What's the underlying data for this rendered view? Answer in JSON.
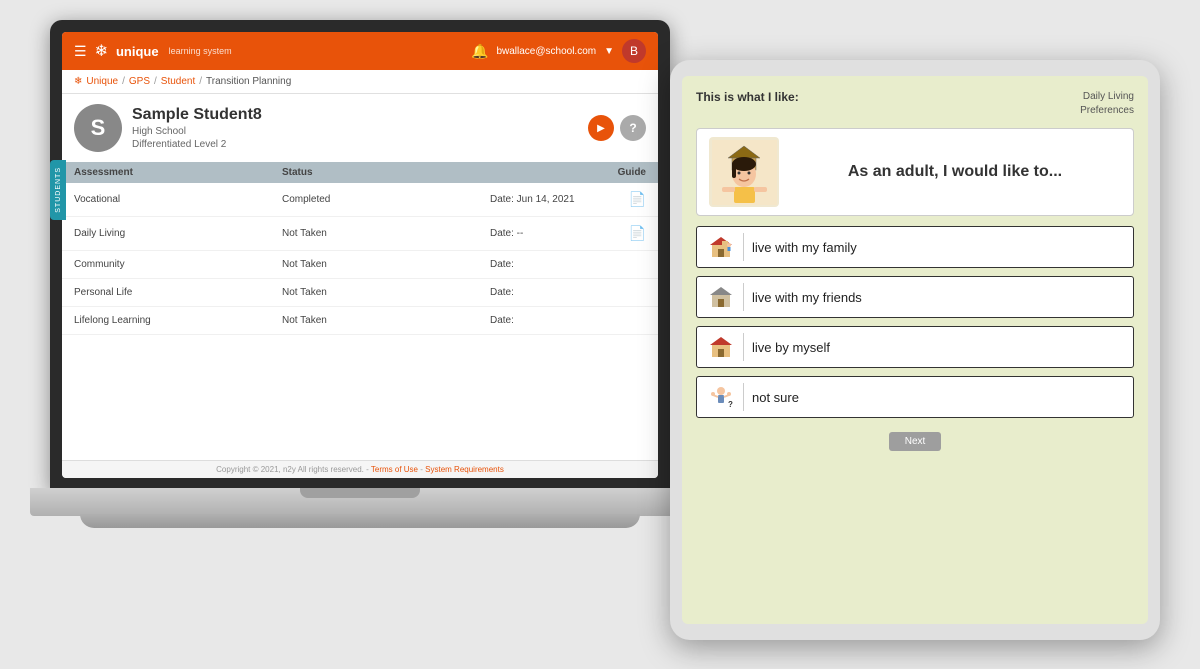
{
  "app": {
    "header": {
      "menu_icon": "☰",
      "logo_snowflake": "❄",
      "logo_text": "unique",
      "logo_sub": "learning system",
      "bell_icon": "🔔",
      "user_email": "bwallace@school.com",
      "chevron": "▼",
      "avatar_letter": "B"
    },
    "breadcrumb": {
      "unique": "Unique",
      "sep1": "/",
      "gps": "GPS",
      "sep2": "/",
      "student": "Student",
      "sep3": "/",
      "current": "Transition Planning"
    },
    "student": {
      "avatar_letter": "S",
      "name": "Sample Student8",
      "school_level": "High School",
      "diff_level": "Differentiated Level 2",
      "play_icon": "▶",
      "help_icon": "?"
    },
    "students_tab": "STUDENTS",
    "table": {
      "headers": [
        "Assessment",
        "Status",
        "Guide"
      ],
      "rows": [
        {
          "assessment": "Vocational",
          "status": "Completed",
          "date": "Date: Jun 14, 2021",
          "has_pdf": true
        },
        {
          "assessment": "Daily Living",
          "status": "Not Taken",
          "date": "Date: --",
          "has_pdf": true
        },
        {
          "assessment": "Community",
          "status": "Not Taken",
          "date": "Date:",
          "has_pdf": false
        },
        {
          "assessment": "Personal Life",
          "status": "Not Taken",
          "date": "Date:",
          "has_pdf": false
        },
        {
          "assessment": "Lifelong Learning",
          "status": "Not Taken",
          "date": "Date:",
          "has_pdf": false
        }
      ]
    },
    "footer": {
      "copyright": "Copyright © 2021, n2y All rights reserved. -",
      "terms_link": "Terms of Use",
      "separator": "-",
      "system_link": "System Requirements"
    }
  },
  "tablet": {
    "title": "This is what I like:",
    "section_line1": "Daily Living",
    "section_line2": "Preferences",
    "question_text": "As an adult, I would like to...",
    "options": [
      {
        "text": "live with my family",
        "icon": "🏠"
      },
      {
        "text": "live with my friends",
        "icon": "🏠"
      },
      {
        "text": "live by myself",
        "icon": "🏠"
      },
      {
        "text": "not sure",
        "icon": "🤷"
      }
    ],
    "next_button": "Next"
  }
}
